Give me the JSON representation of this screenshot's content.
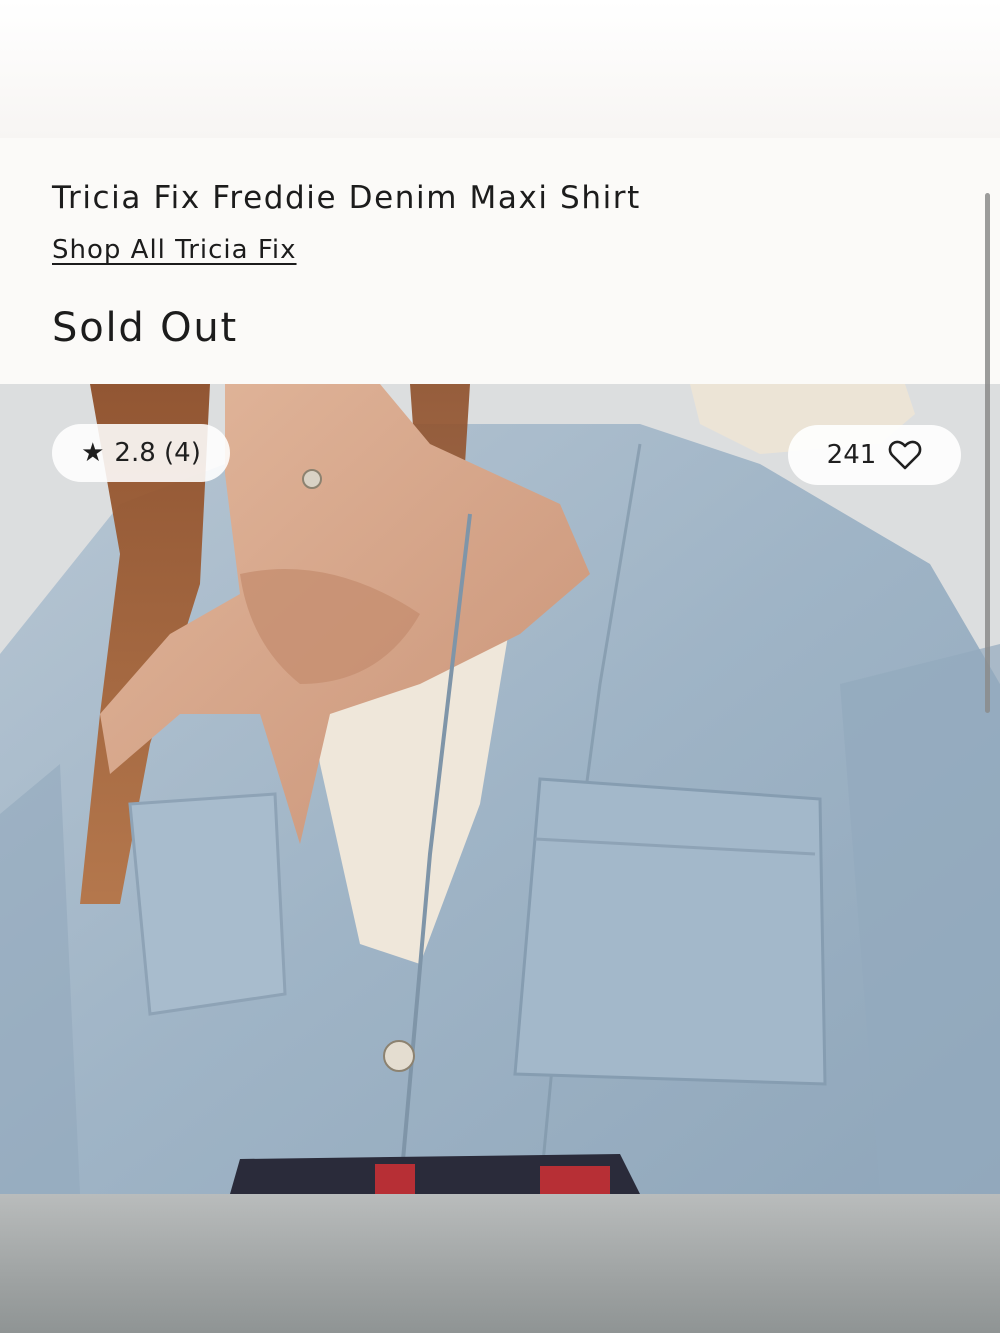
{
  "product": {
    "title": "Tricia Fix Freddie Denim Maxi Shirt",
    "brand_link": "Shop All Tricia Fix",
    "status": "Sold Out"
  },
  "rating": {
    "icon": "star-icon",
    "text": "2.8 (4)"
  },
  "favorites": {
    "count": "241",
    "icon": "heart-icon"
  },
  "colors": {
    "denim": "#9db3c6",
    "scarf": "#d9a98a",
    "hair": "#a65f34",
    "background": "#faf9f7"
  }
}
